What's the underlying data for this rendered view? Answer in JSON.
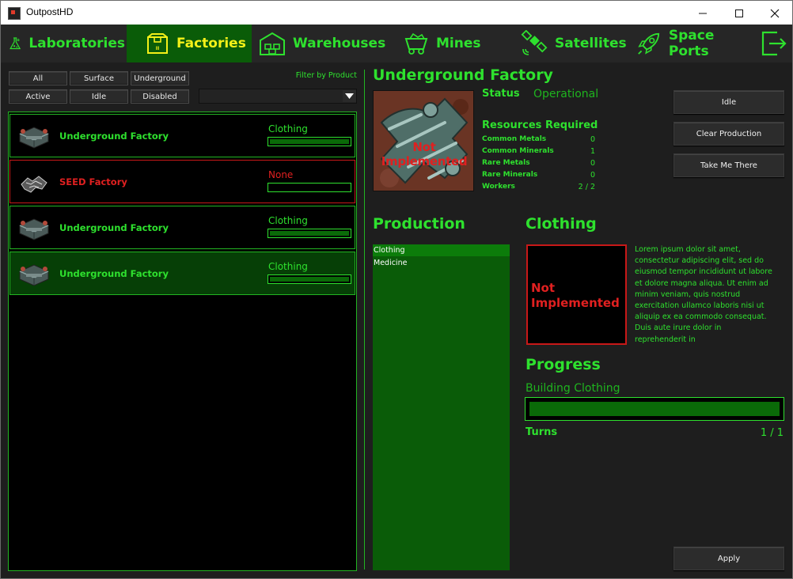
{
  "window": {
    "title": "OutpostHD"
  },
  "tabs": [
    {
      "label": "Laboratories",
      "icon": "flask-icon",
      "active": false
    },
    {
      "label": "Factories",
      "icon": "factory-box-icon",
      "active": true
    },
    {
      "label": "Warehouses",
      "icon": "warehouse-icon",
      "active": false
    },
    {
      "label": "Mines",
      "icon": "mine-cart-icon",
      "active": false
    },
    {
      "label": "Satellites",
      "icon": "satellite-icon",
      "active": false
    },
    {
      "label": "Space Ports",
      "icon": "rocket-icon",
      "active": false
    }
  ],
  "filters": {
    "row1": [
      "All",
      "Surface",
      "Underground"
    ],
    "row2": [
      "Active",
      "Idle",
      "Disabled"
    ],
    "filter_by_product_label": "Filter by Product",
    "product_dropdown_value": ""
  },
  "factories": [
    {
      "name": "Underground Factory",
      "production": "Clothing",
      "progress": 1.0,
      "status": "ok",
      "selected": false
    },
    {
      "name": "SEED Factory",
      "production": "None",
      "progress": 0,
      "status": "error",
      "selected": false
    },
    {
      "name": "Underground Factory",
      "production": "Clothing",
      "progress": 1.0,
      "status": "ok",
      "selected": false
    },
    {
      "name": "Underground Factory",
      "production": "Clothing",
      "progress": 1.0,
      "status": "ok",
      "selected": true
    }
  ],
  "detail": {
    "title": "Underground Factory",
    "image_text": "Not Implemented",
    "status_label": "Status",
    "status_value": "Operational",
    "resources_title": "Resources Required",
    "resources": [
      {
        "label": "Common Metals",
        "value": "0"
      },
      {
        "label": "Common Minerals",
        "value": "1"
      },
      {
        "label": "Rare Metals",
        "value": "0"
      },
      {
        "label": "Rare Minerals",
        "value": "0"
      },
      {
        "label": "Workers",
        "value": "2 / 2"
      }
    ],
    "buttons": {
      "idle": "Idle",
      "clear": "Clear Production",
      "take_me": "Take Me There",
      "apply": "Apply"
    }
  },
  "production": {
    "title": "Production",
    "items": [
      "Clothing",
      "Medicine"
    ],
    "selected_index": 0
  },
  "product_info": {
    "title": "Clothing",
    "image_text_line1": "Not",
    "image_text_line2": "Implemented",
    "description": "Lorem ipsum dolor sit amet, consectetur adipiscing elit, sed do eiusmod tempor incididunt ut labore et dolore magna aliqua. Ut enim ad minim veniam, quis nostrud exercitation ullamco laboris nisi ut aliquip ex ea commodo consequat. Duis aute irure dolor in reprehenderit in"
  },
  "progress": {
    "title": "Progress",
    "building_text": "Building Clothing",
    "fraction": 1.0,
    "turns_label": "Turns",
    "turns_value": "1 / 1"
  },
  "colors": {
    "accent_green": "#2ee12e",
    "active_tab_bg": "#0a5c08",
    "active_tab_text": "#f4f018",
    "error_red": "#e02020"
  }
}
